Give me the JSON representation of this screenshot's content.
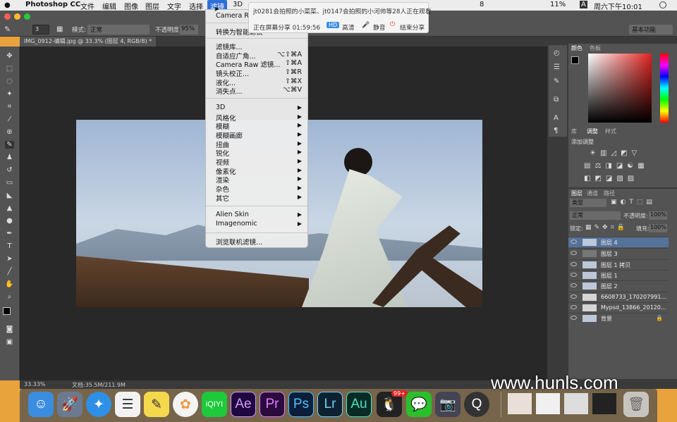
{
  "menubar": {
    "app_name": "Photoshop CC",
    "items": [
      "文件",
      "编辑",
      "图像",
      "图层",
      "文字",
      "选择",
      "滤镜",
      "3D"
    ],
    "status": {
      "battery": "11%",
      "datetime": "周六下午10:01",
      "input": "A",
      "notifications": "8"
    }
  },
  "share": {
    "viewers": "jt0281会拍照的小菜菜、jt0147会拍照的小河帅等28人正在观看",
    "sharing": "正在屏幕分享 01:59:56",
    "hd": "HD",
    "quality": "高清",
    "mute": "静音",
    "stop": "结束分享"
  },
  "options": {
    "brush_size": "3",
    "mode_label": "模式:",
    "mode_value": "正常",
    "opacity_label": "不透明度:",
    "opacity_value": "95%",
    "workspace": "基本功能"
  },
  "document": {
    "tab": "IMG_0912-编辑.jpg @ 33.3% (图层 4, RGB/8) *"
  },
  "status": {
    "zoom": "33.33%",
    "doc": "文档:35.5M/211.9M"
  },
  "filter_menu": {
    "top_item": "Camera Raw",
    "convert": "转换为智能滤镜",
    "group1": [
      {
        "label": "滤镜库...",
        "shortcut": ""
      },
      {
        "label": "自适应广角...",
        "shortcut": "⌥⇧⌘A"
      },
      {
        "label": "Camera Raw 滤镜...",
        "shortcut": "⇧⌘A"
      },
      {
        "label": "镜头校正...",
        "shortcut": "⇧⌘R"
      },
      {
        "label": "液化...",
        "shortcut": "⇧⌘X"
      },
      {
        "label": "消失点...",
        "shortcut": "⌥⌘V"
      }
    ],
    "group2": [
      "3D",
      "风格化",
      "模糊",
      "模糊画廊",
      "扭曲",
      "锐化",
      "视频",
      "像素化",
      "渲染",
      "杂色",
      "其它"
    ],
    "group3": [
      "Alien Skin",
      "Imagenomic"
    ],
    "browse": "浏览联机滤镜..."
  },
  "panels": {
    "color_tabs": [
      "颜色",
      "色板"
    ],
    "adjust_tabs": [
      "库",
      "调整",
      "样式"
    ],
    "adjust_title": "添加调整",
    "layer_tabs": [
      "图层",
      "通道",
      "路径"
    ],
    "filter_kind": "类型",
    "blend_mode": "正常",
    "opacity_label": "不透明度:",
    "opacity_value": "100%",
    "lock_label": "锁定:",
    "fill_label": "填充:",
    "fill_value": "100%"
  },
  "layers": [
    {
      "name": "图层 4",
      "selected": true
    },
    {
      "name": "图层 3",
      "selected": false
    },
    {
      "name": "图层 1 拷贝",
      "selected": false
    },
    {
      "name": "图层 1",
      "selected": false
    },
    {
      "name": "图层 2",
      "selected": false
    },
    {
      "name": "6608733_170207991...",
      "selected": false
    },
    {
      "name": "Mypsd_13866_20120...",
      "selected": false
    },
    {
      "name": "背景",
      "selected": false
    }
  ],
  "dock": [
    {
      "name": "finder",
      "label": "",
      "bg": "#3b8de0"
    },
    {
      "name": "launchpad",
      "label": "",
      "bg": "#6b7a8f"
    },
    {
      "name": "safari",
      "label": "",
      "bg": "#2e8fe6"
    },
    {
      "name": "reminders",
      "label": "",
      "bg": "#f2f2f2"
    },
    {
      "name": "notes",
      "label": "",
      "bg": "#f5d94d"
    },
    {
      "name": "photos",
      "label": "",
      "bg": "#f4f4f4"
    },
    {
      "name": "iqiyi",
      "label": "iQIYI",
      "bg": "#1ec93b"
    },
    {
      "name": "after-effects",
      "label": "Ae",
      "bg": "#1f0740"
    },
    {
      "name": "premiere",
      "label": "Pr",
      "bg": "#2a0b3d"
    },
    {
      "name": "photoshop",
      "label": "Ps",
      "bg": "#0b1f3a"
    },
    {
      "name": "lightroom",
      "label": "Lr",
      "bg": "#0d2230"
    },
    {
      "name": "audition",
      "label": "Au",
      "bg": "#0a2b25"
    },
    {
      "name": "qq",
      "label": "",
      "bg": "#222"
    },
    {
      "name": "wechat",
      "label": "",
      "bg": "#2bc02b"
    },
    {
      "name": "preview",
      "label": "",
      "bg": "#445"
    },
    {
      "name": "quicktime",
      "label": "",
      "bg": "#333"
    }
  ],
  "dock_badge": "99+",
  "watermark": "www.hunls.com"
}
